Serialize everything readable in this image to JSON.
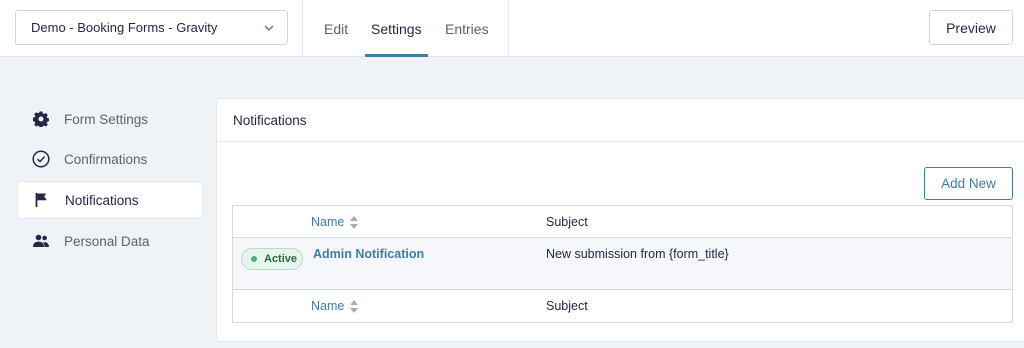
{
  "header": {
    "form_selector": {
      "value": "Demo - Booking Forms - Gravity"
    },
    "tabs": [
      {
        "label": "Edit"
      },
      {
        "label": "Settings"
      },
      {
        "label": "Entries"
      }
    ],
    "active_tab": "Settings",
    "preview_label": "Preview"
  },
  "sidebar": {
    "items": [
      {
        "label": "Form Settings",
        "icon": "gear-icon"
      },
      {
        "label": "Confirmations",
        "icon": "check-circle-icon"
      },
      {
        "label": "Notifications",
        "icon": "flag-icon"
      },
      {
        "label": "Personal Data",
        "icon": "users-icon"
      }
    ],
    "active_item": "Notifications"
  },
  "panel": {
    "title": "Notifications",
    "add_new_label": "Add New",
    "table": {
      "columns": {
        "name": "Name",
        "subject": "Subject"
      },
      "rows": [
        {
          "status": "Active",
          "name": "Admin Notification",
          "subject": "New submission from {form_title}"
        }
      ]
    }
  },
  "colors": {
    "accent": "#3e7da6",
    "active_badge_bg": "#e6f4eb",
    "active_badge_text": "#276a45",
    "page_bg": "#eff3f8"
  }
}
